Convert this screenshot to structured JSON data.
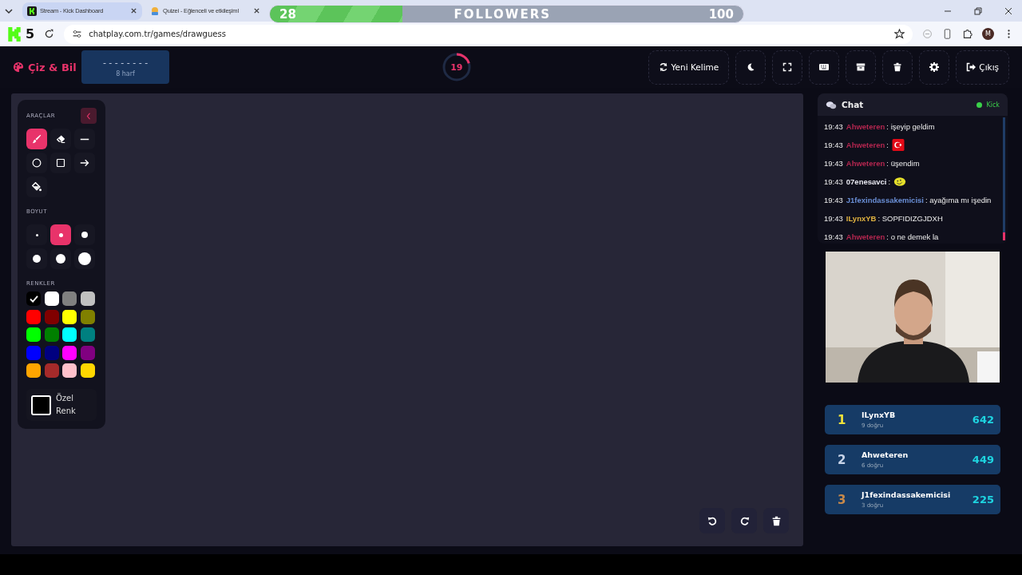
{
  "browser": {
    "tabs": [
      {
        "title": "Stream - Kick Dashboard",
        "selected": true
      },
      {
        "title": "Quizei - Eğlenceli ve etkileşiml",
        "selected": false
      }
    ],
    "url": "chatplay.com.tr/games/drawguess",
    "profile": "M"
  },
  "overlay": {
    "badge": "5",
    "followers": {
      "current": "28",
      "label": "FOLLOWERS",
      "goal": "100",
      "level": 0.28
    }
  },
  "header": {
    "logo": "Çiz & Bil",
    "word": "- - - - - - - -",
    "word_hint": "8 harf",
    "timer": {
      "value": "19"
    },
    "buttons": [
      {
        "kind": "refresh",
        "label": "Yeni Kelime"
      },
      {
        "kind": "moon"
      },
      {
        "kind": "expand"
      },
      {
        "kind": "keyboard"
      },
      {
        "kind": "archive"
      },
      {
        "kind": "trash"
      },
      {
        "kind": "gear"
      },
      {
        "kind": "logout",
        "label": "Çıkış"
      }
    ]
  },
  "tools": {
    "title": "ARAÇLAR",
    "items": [
      {
        "kind": "brush",
        "selected": true
      },
      {
        "kind": "eraser",
        "selected": false
      },
      {
        "kind": "line",
        "selected": false
      },
      {
        "kind": "circle",
        "selected": false
      },
      {
        "kind": "square",
        "selected": false
      },
      {
        "kind": "arrow",
        "selected": false
      },
      {
        "kind": "fill",
        "selected": false
      }
    ],
    "size_title": "BOYUT",
    "sizes": [
      {
        "selected": false
      },
      {
        "selected": true
      },
      {
        "selected": false
      },
      {
        "selected": false
      },
      {
        "selected": false
      },
      {
        "selected": false
      }
    ],
    "colors_title": "RENKLER",
    "colors": [
      {
        "color": "#000000",
        "selected": true
      },
      {
        "color": "#ffffff",
        "selected": false
      },
      {
        "color": "#808080",
        "selected": false
      },
      {
        "color": "#c0c0c0",
        "selected": false
      },
      {
        "color": "#ff0000",
        "selected": false
      },
      {
        "color": "#800000",
        "selected": false
      },
      {
        "color": "#ffff00",
        "selected": false
      },
      {
        "color": "#808000",
        "selected": false
      },
      {
        "color": "#00ff00",
        "selected": false
      },
      {
        "color": "#008000",
        "selected": false
      },
      {
        "color": "#00ffff",
        "selected": false
      },
      {
        "color": "#008080",
        "selected": false
      },
      {
        "color": "#0000ff",
        "selected": false
      },
      {
        "color": "#000080",
        "selected": false
      },
      {
        "color": "#ff00ff",
        "selected": false
      },
      {
        "color": "#800080",
        "selected": false
      },
      {
        "color": "#ffa500",
        "selected": false
      },
      {
        "color": "#a52a2a",
        "selected": false
      },
      {
        "color": "#ffc0cb",
        "selected": false
      },
      {
        "color": "#ffd700",
        "selected": false
      }
    ],
    "custom": {
      "label": "Özel Renk",
      "color": "#000000"
    }
  },
  "canvas_buttons": [
    {
      "kind": "undo"
    },
    {
      "kind": "redo"
    },
    {
      "kind": "trash"
    }
  ],
  "chat": {
    "title": "Chat",
    "source": "Kick",
    "messages": [
      {
        "time": "19:43",
        "user": "Ahweteren",
        "color": "#b3264f",
        "kind": "text",
        "text": ": işeyip geldim"
      },
      {
        "time": "19:43",
        "user": "Ahweteren",
        "color": "#b3264f",
        "kind": "flag",
        "text": ":"
      },
      {
        "time": "19:43",
        "user": "Ahweteren",
        "color": "#b3264f",
        "kind": "text",
        "text": ": üşendim"
      },
      {
        "time": "19:43",
        "user": "07enesavci",
        "color": "#e8e8f0",
        "kind": "smiley",
        "text": ":"
      },
      {
        "time": "19:43",
        "user": "J1fexindassakemicisi",
        "color": "#6a8fd6",
        "kind": "text",
        "text": ": ayağıma mı işedin"
      },
      {
        "time": "19:43",
        "user": "ILynxYB",
        "color": "#e2b441",
        "kind": "text",
        "text": ": SOPFIDIZGJDXH"
      },
      {
        "time": "19:43",
        "user": "Ahweteren",
        "color": "#b3264f",
        "kind": "text",
        "text": ": o ne demek la"
      }
    ]
  },
  "leaderboard": [
    {
      "rank": "1",
      "name": "ILynxYB",
      "sub": "9 doğru",
      "score": "642",
      "color": "#f2e33a"
    },
    {
      "rank": "2",
      "name": "Ahweteren",
      "sub": "6 doğru",
      "score": "449",
      "color": "#c8d4e8"
    },
    {
      "rank": "3",
      "name": "J1fexindassakemicisi",
      "sub": "3 doğru",
      "score": "225",
      "color": "#c98a4a"
    }
  ]
}
